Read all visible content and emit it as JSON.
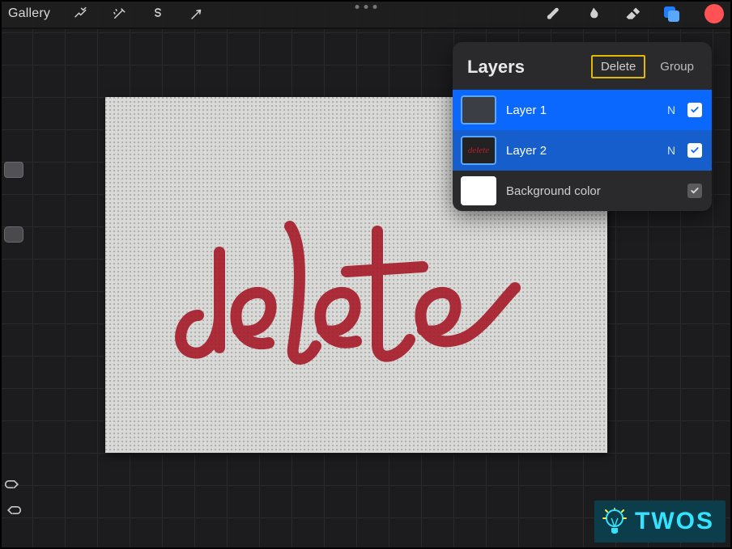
{
  "toolbar": {
    "gallery_label": "Gallery"
  },
  "layers_panel": {
    "title": "Layers",
    "delete_label": "Delete",
    "group_label": "Group",
    "items": [
      {
        "name": "Layer 1",
        "blend": "N",
        "visible": true,
        "selected": true
      },
      {
        "name": "Layer 2",
        "blend": "N",
        "visible": true,
        "selected": true
      },
      {
        "name": "Background color",
        "blend": "",
        "visible": true,
        "is_background": true
      }
    ]
  },
  "canvas": {
    "word": "delete"
  },
  "colors": {
    "accent_blue": "#0a68ff",
    "highlight_yellow": "#e3b800",
    "swatch": "#ff5255",
    "brush_red": "#a51a28"
  },
  "watermark": {
    "text": "TWOS"
  }
}
